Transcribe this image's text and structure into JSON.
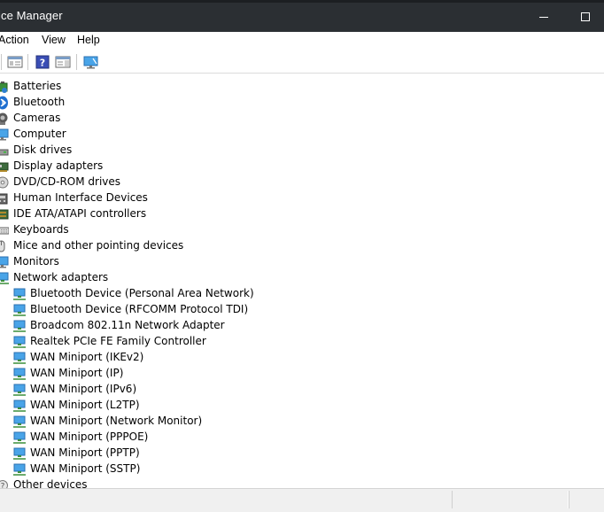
{
  "window": {
    "title": "ice Manager"
  },
  "menu": {
    "items": [
      "Action",
      "View",
      "Help"
    ]
  },
  "toolbar": {
    "buttons": [
      "back-icon",
      "properties-icon",
      "help-icon",
      "action-pane-icon",
      "monitor-icon"
    ]
  },
  "tree": {
    "categories": [
      {
        "label": "Batteries",
        "icon": "battery-icon"
      },
      {
        "label": "Bluetooth",
        "icon": "bluetooth-icon"
      },
      {
        "label": "Cameras",
        "icon": "camera-icon"
      },
      {
        "label": "Computer",
        "icon": "computer-icon"
      },
      {
        "label": "Disk drives",
        "icon": "disk-drive-icon"
      },
      {
        "label": "Display adapters",
        "icon": "display-adapter-icon"
      },
      {
        "label": "DVD/CD-ROM drives",
        "icon": "dvd-drive-icon"
      },
      {
        "label": "Human Interface Devices",
        "icon": "hid-icon"
      },
      {
        "label": "IDE ATA/ATAPI controllers",
        "icon": "ide-controller-icon"
      },
      {
        "label": "Keyboards",
        "icon": "keyboard-icon"
      },
      {
        "label": "Mice and other pointing devices",
        "icon": "mouse-icon"
      },
      {
        "label": "Monitors",
        "icon": "monitor-icon"
      },
      {
        "label": "Network adapters",
        "icon": "network-adapter-icon"
      }
    ],
    "network_adapters": [
      "Bluetooth Device (Personal Area Network)",
      "Bluetooth Device (RFCOMM Protocol TDI)",
      "Broadcom 802.11n Network Adapter",
      "Realtek PCIe FE Family Controller",
      "WAN Miniport (IKEv2)",
      "WAN Miniport (IP)",
      "WAN Miniport (IPv6)",
      "WAN Miniport (L2TP)",
      "WAN Miniport (Network Monitor)",
      "WAN Miniport (PPPOE)",
      "WAN Miniport (PPTP)",
      "WAN Miniport (SSTP)"
    ],
    "after": [
      {
        "label": "Other devices",
        "icon": "other-devices-icon"
      }
    ]
  },
  "colors": {
    "titlebar": "#2b2f33",
    "network_icon": "#2f8fd8",
    "accent": "#0078d7"
  }
}
